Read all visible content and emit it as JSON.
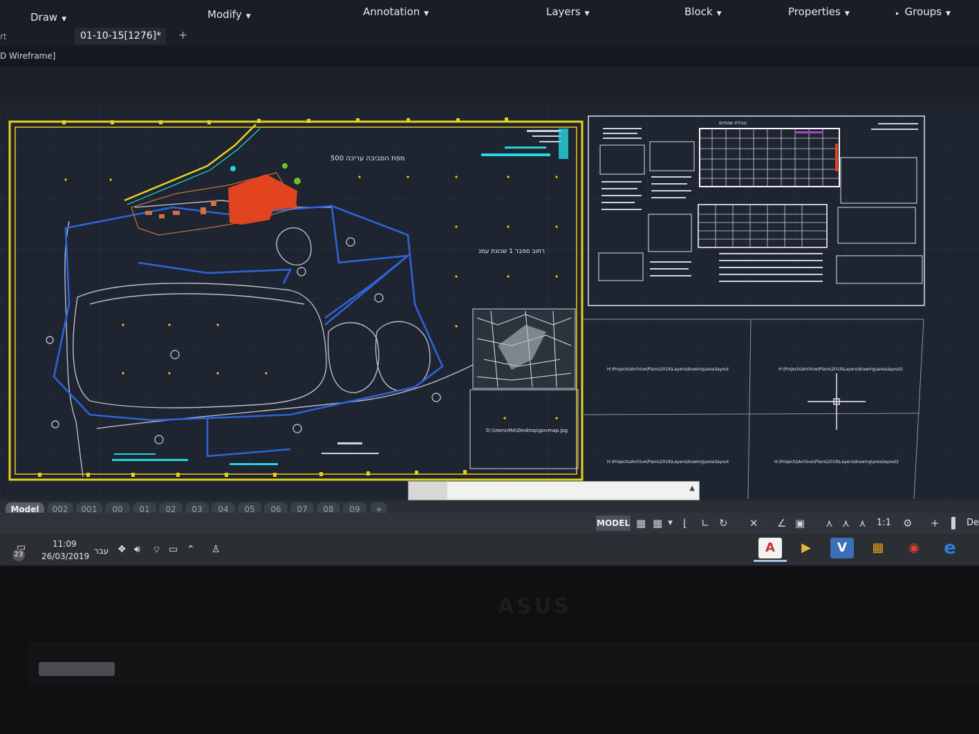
{
  "ribbon": {
    "panels": [
      "Draw",
      "Modify",
      "Annotation",
      "Layers",
      "Block",
      "Properties",
      "Groups"
    ]
  },
  "document_tab": {
    "label": "01-10-15[1276]*"
  },
  "left_cut_text": "rt",
  "viewport_label": "D Wireframe]",
  "drawing": {
    "site_title": "מפת הסביבה עריכה 500",
    "site_label": "רחוב ספבר 1 שכונת עמנ",
    "image_path": "D:\\Users\\MA\\Desktop\\govmap.jpg",
    "xref_path_1": "H:\\Projects\\Archive\\Plans\\2019\\Layers\\drawing\\area\\layout",
    "xref_path_2": "H:\\Projects\\Archive\\Plans\\2019\\Layers\\drawing\\area\\layout2",
    "legend_header": "טבלת שטחים"
  },
  "layout_tabs": [
    "Model",
    "002",
    "001",
    "00",
    "01",
    "02",
    "03",
    "04",
    "05",
    "06",
    "07",
    "08",
    "09"
  ],
  "statusbar": {
    "model_label": "MODEL",
    "scale": "1:1",
    "trailing": "De"
  },
  "taskbar": {
    "time": "11:09",
    "date": "26/03/2019",
    "language": "עבר",
    "notification_count": "23",
    "apps": [
      {
        "name": "autocad",
        "glyph": "A",
        "color": "#c8322c"
      },
      {
        "name": "media",
        "glyph": "▶",
        "color": "#e2b93b"
      },
      {
        "name": "visio",
        "glyph": "V",
        "color": "#3d6fb6"
      },
      {
        "name": "store",
        "glyph": "▦",
        "color": "#e0a020"
      },
      {
        "name": "chrome",
        "glyph": "◉",
        "color": "#d9432f"
      },
      {
        "name": "edge",
        "glyph": "e",
        "color": "#2f7fd6"
      }
    ]
  },
  "bezel": {
    "brand": "ASUS"
  },
  "colors": {
    "frame_yellow": "#e6d21c",
    "boundary_blue": "#2f63d9",
    "building_red": "#e2441f",
    "cyan_text": "#24d6e4"
  }
}
